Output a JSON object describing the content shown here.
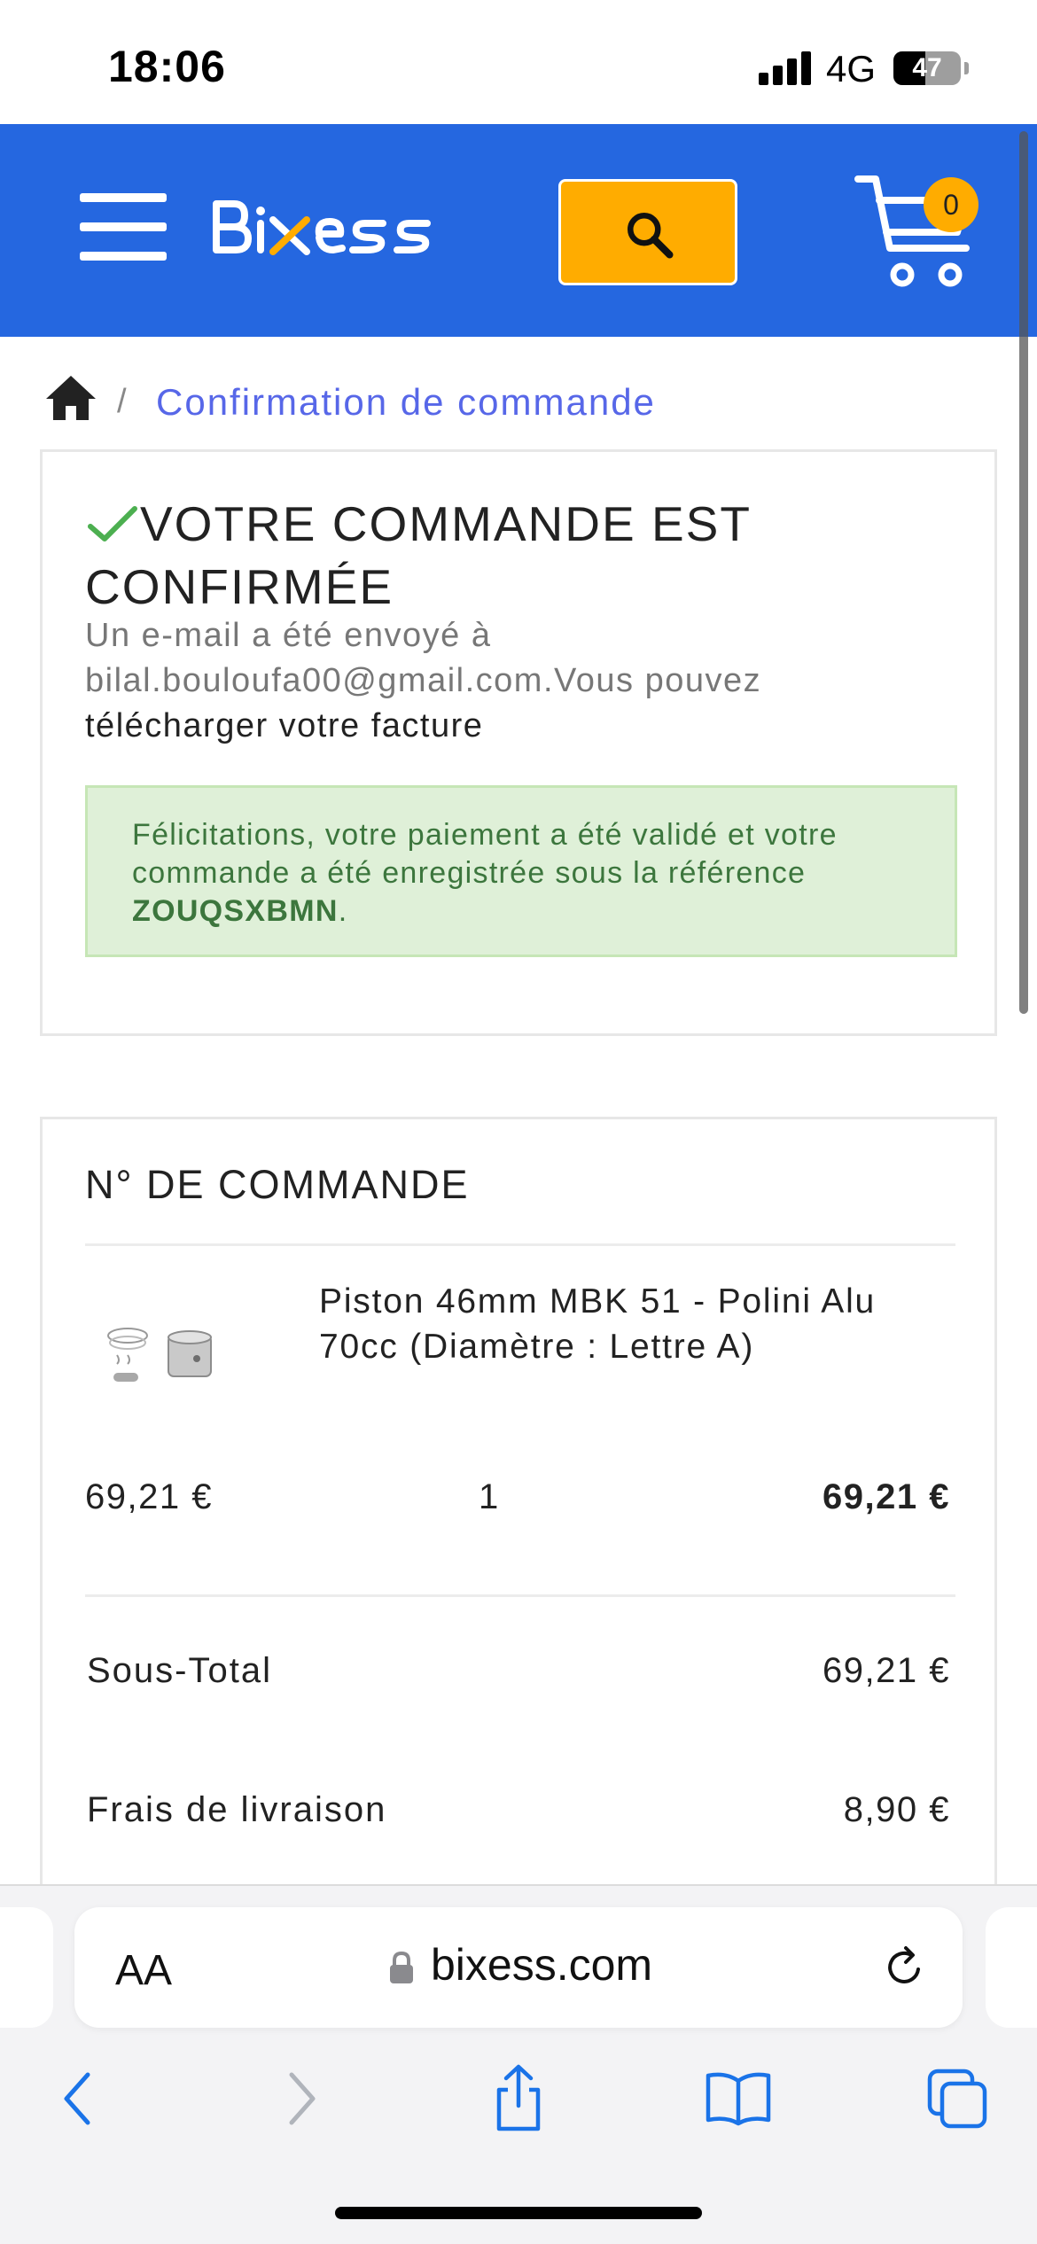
{
  "status_bar": {
    "time": "18:06",
    "network": "4G",
    "battery": "47",
    "battery_level": 0.47
  },
  "header": {
    "brand": "Bixess",
    "cart_count": "0",
    "colors": {
      "bar": "#2567e0",
      "accent": "#ffac00"
    },
    "icons": [
      "menu-icon",
      "search-icon",
      "cart-icon"
    ]
  },
  "breadcrumb": {
    "home_icon": "home-icon",
    "separator": "/",
    "current": "Confirmation de commande"
  },
  "confirmation": {
    "title": "VOTRE COMMANDE EST CONFIRMÉE",
    "email_line": "Un e-mail a été envoyé à bilal.bouloufa00@gmail.com.Vous pouvez",
    "invoice_link": "télécharger votre facture",
    "alert_text": "Félicitations, votre paiement a été validé et votre commande a été enregistrée sous la référence",
    "reference": "ZOUQSXBMN",
    "alert_end": ".",
    "colors": {
      "check": "#4caf50",
      "alert_bg": "#dff0d8",
      "alert_text": "#3c763d"
    }
  },
  "order": {
    "title": "N° DE COMMANDE",
    "items": [
      {
        "name": "Piston 46mm MBK 51 - Polini Alu 70cc (Diamètre : Lettre A)",
        "unit_price": "69,21 €",
        "quantity": "1",
        "total": "69,21 €"
      }
    ],
    "summary": [
      {
        "label": "Sous-Total",
        "value": "69,21 €"
      },
      {
        "label": "Frais de livraison",
        "value": "8,90 €"
      }
    ]
  },
  "browser": {
    "text_size_label": "AA",
    "url": "bixess.com",
    "icons": [
      "lock-icon",
      "reload-icon",
      "back-icon",
      "forward-icon",
      "share-icon",
      "bookmarks-icon",
      "tabs-icon"
    ]
  }
}
